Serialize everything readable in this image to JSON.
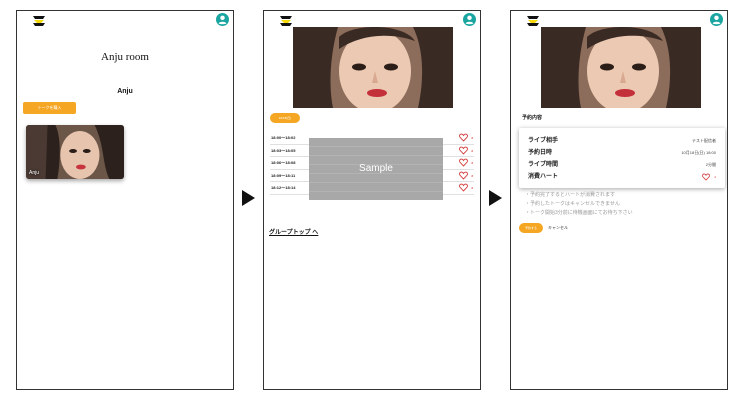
{
  "colors": {
    "accent": "#f5a623",
    "user_icon": "#1aa5a0",
    "heart": "#d33c3c",
    "frame": "#333333"
  },
  "icons": {
    "logo": "logo-icon",
    "user": "account-circle-icon",
    "heart": "heart-outline-icon",
    "arrow": "play-arrow-icon"
  },
  "screen1": {
    "room_title": "Anju room",
    "member_name": "Anju",
    "talk_button": "トークを購入",
    "card_name": "Anju"
  },
  "screen2": {
    "date_pill": "10/18(日)",
    "slots": [
      {
        "time": "18:00〜18:02",
        "count": "2"
      },
      {
        "time": "18:03〜18:05",
        "count": "2"
      },
      {
        "time": "18:06〜18:08",
        "count": "2"
      },
      {
        "time": "18:09〜18:11",
        "count": "2"
      },
      {
        "time": "18:12〜18:14",
        "count": "2"
      }
    ],
    "sample_label": "Sample",
    "group_link": "グループトップ へ"
  },
  "screen3": {
    "section_title": "予約内容",
    "rows": [
      {
        "label": "ライブ相手",
        "value": "テスト配信者"
      },
      {
        "label": "予約日時",
        "value": "10月18日(日) 18:00"
      },
      {
        "label": "ライブ時間",
        "value": "2分間"
      },
      {
        "label": "消費ハート",
        "value": "2"
      }
    ],
    "notes": [
      "・予約完了するとハートが消費されます",
      "・予約したトークはキャンセルできません",
      "・トーク開始3分前に待機画面にてお待ち下さい"
    ],
    "confirm_button": "予約する",
    "cancel_link": "キャンセル"
  }
}
